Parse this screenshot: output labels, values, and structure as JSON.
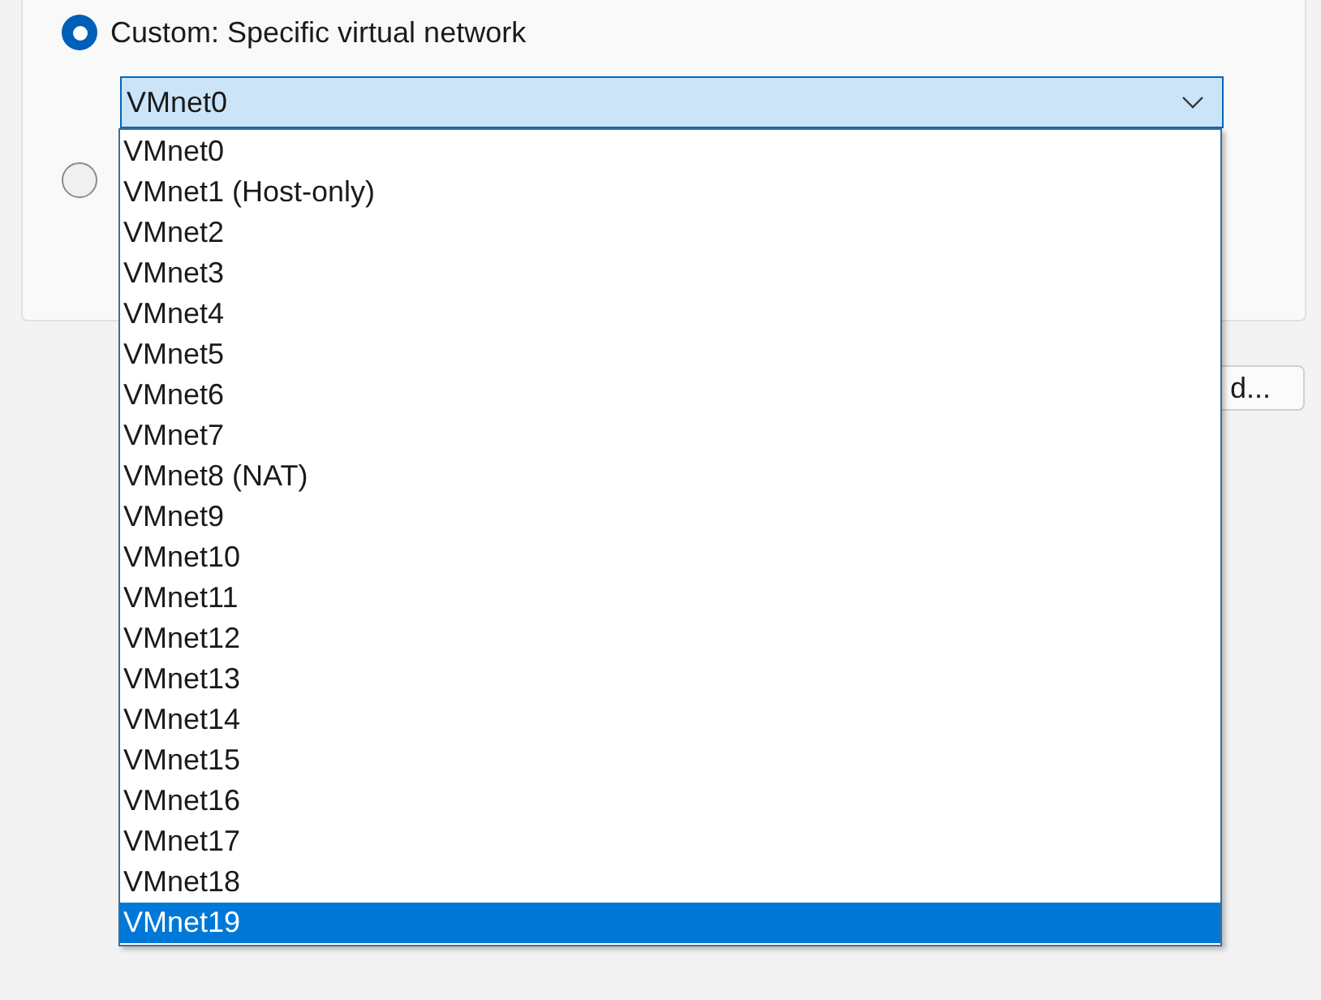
{
  "network_options": [
    {
      "label": "Custom: Specific virtual network",
      "selected": true
    },
    {
      "selected": false
    }
  ],
  "network_combo": {
    "value": "VMnet0",
    "expanded": true,
    "items": [
      {
        "label": "VMnet0",
        "highlighted": false
      },
      {
        "label": "VMnet1 (Host-only)",
        "highlighted": false
      },
      {
        "label": "VMnet2",
        "highlighted": false
      },
      {
        "label": "VMnet3",
        "highlighted": false
      },
      {
        "label": "VMnet4",
        "highlighted": false
      },
      {
        "label": "VMnet5",
        "highlighted": false
      },
      {
        "label": "VMnet6",
        "highlighted": false
      },
      {
        "label": "VMnet7",
        "highlighted": false
      },
      {
        "label": "VMnet8 (NAT)",
        "highlighted": false
      },
      {
        "label": "VMnet9",
        "highlighted": false
      },
      {
        "label": "VMnet10",
        "highlighted": false
      },
      {
        "label": "VMnet11",
        "highlighted": false
      },
      {
        "label": "VMnet12",
        "highlighted": false
      },
      {
        "label": "VMnet13",
        "highlighted": false
      },
      {
        "label": "VMnet14",
        "highlighted": false
      },
      {
        "label": "VMnet15",
        "highlighted": false
      },
      {
        "label": "VMnet16",
        "highlighted": false
      },
      {
        "label": "VMnet17",
        "highlighted": false
      },
      {
        "label": "VMnet18",
        "highlighted": false
      },
      {
        "label": "VMnet19",
        "highlighted": true
      }
    ]
  },
  "button": {
    "label": "d..."
  }
}
